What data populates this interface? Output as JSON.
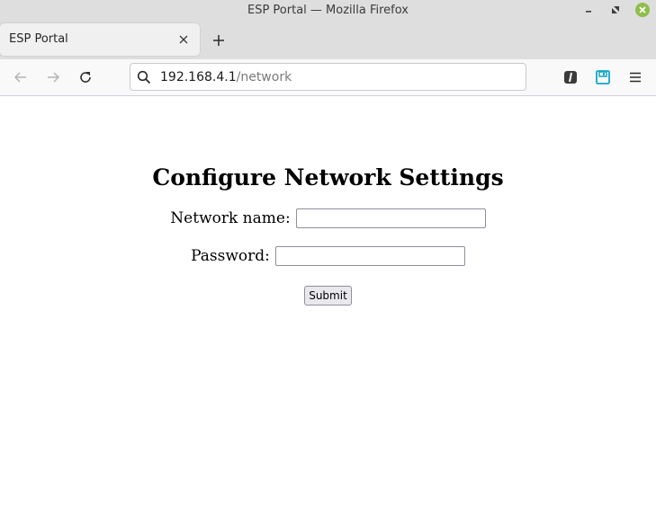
{
  "window": {
    "title": "ESP Portal — Mozilla Firefox"
  },
  "tabs": [
    {
      "title": "ESP Portal",
      "active": true
    }
  ],
  "navbar": {
    "url_host": "192.168.4.1",
    "url_path": "/network"
  },
  "icons": {
    "minimize": "minimize-icon",
    "maximize": "restore-icon",
    "close": "close-icon",
    "tab_close": "close-icon",
    "new_tab": "plus-icon",
    "back": "arrow-left-icon",
    "forward": "arrow-right-icon",
    "reload": "reload-icon",
    "search": "search-icon",
    "pocket": "pocket-icon",
    "save": "save-icon",
    "menu": "hamburger-menu-icon"
  },
  "colors": {
    "window_close_bg": "#8fbd4a",
    "save_icon": "#12a6c7"
  },
  "page": {
    "heading": "Configure Network Settings",
    "network_label": "Network name:",
    "network_value": "",
    "password_label": "Password:",
    "password_value": "",
    "submit_label": "Submit"
  }
}
